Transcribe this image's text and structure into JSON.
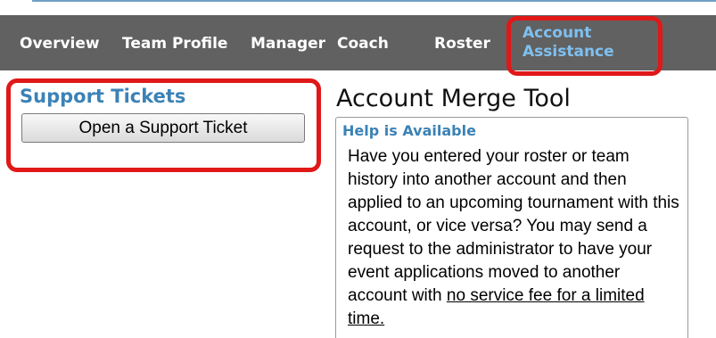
{
  "nav": {
    "items": [
      {
        "label": "Overview"
      },
      {
        "label": "Team Profile"
      },
      {
        "label": "Manager"
      },
      {
        "label": "Coach"
      },
      {
        "label": "Roster"
      }
    ],
    "active": {
      "line1": "Account",
      "line2": "Assistance"
    }
  },
  "support": {
    "title": "Support Tickets",
    "button_label": "Open a Support Ticket"
  },
  "merge": {
    "title": "Account Merge Tool",
    "heading": "Help is Available",
    "body_text": "Have you entered your roster or team history into another account and then applied to an upcoming tournament with this account, or vice versa? You may send a request to the administrator to have your event applications moved to another account with ",
    "link_text": "no service fee for a limited time."
  },
  "colors": {
    "nav_bg": "#616161",
    "nav_active": "#7fc0f0",
    "accent": "#3b82b6",
    "highlight": "#e01818"
  }
}
